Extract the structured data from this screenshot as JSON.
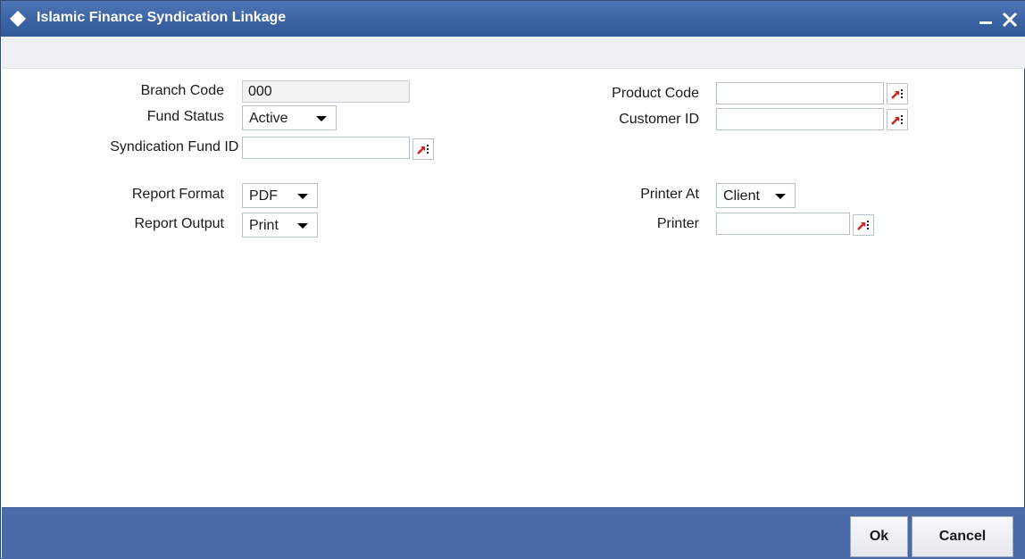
{
  "window": {
    "title": "Islamic Finance Syndication Linkage"
  },
  "form": {
    "branch_code": {
      "label": "Branch Code",
      "value": "000"
    },
    "fund_status": {
      "label": "Fund Status",
      "value": "Active"
    },
    "syndication_fund_id": {
      "label": "Syndication Fund ID",
      "required_marker": "*",
      "value": ""
    },
    "product_code": {
      "label": "Product Code",
      "value": ""
    },
    "customer_id": {
      "label": "Customer ID",
      "value": ""
    },
    "report_format": {
      "label": "Report Format",
      "value": "PDF"
    },
    "report_output": {
      "label": "Report Output",
      "value": "Print"
    },
    "printer_at": {
      "label": "Printer At",
      "value": "Client"
    },
    "printer": {
      "label": "Printer",
      "value": ""
    }
  },
  "footer": {
    "ok_label": "Ok",
    "cancel_label": "Cancel"
  },
  "icons": {
    "title": "diamond-icon",
    "lov": "list-of-values-icon",
    "minimize": "minimize-icon",
    "close": "close-icon",
    "dropdown": "chevron-down-icon"
  },
  "colors": {
    "titlebar": "#3b63a3",
    "footer": "#4a6aa8",
    "required": "#cc1111",
    "lov_arrow": "#d62020"
  }
}
